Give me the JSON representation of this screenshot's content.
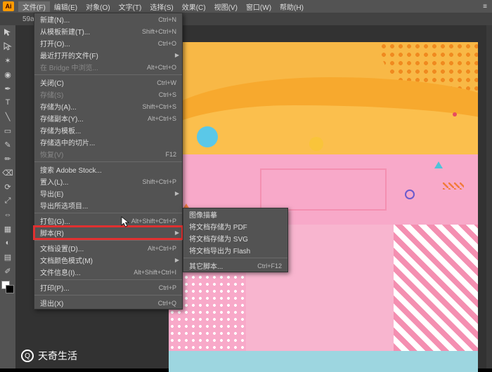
{
  "app": {
    "logo": "Ai"
  },
  "menubar": {
    "items": [
      {
        "label": "文件(F)"
      },
      {
        "label": "编辑(E)"
      },
      {
        "label": "对象(O)"
      },
      {
        "label": "文字(T)"
      },
      {
        "label": "选择(S)"
      },
      {
        "label": "效果(C)"
      },
      {
        "label": "视图(V)"
      },
      {
        "label": "窗口(W)"
      },
      {
        "label": "帮助(H)"
      }
    ]
  },
  "tab": {
    "label": "59a4…"
  },
  "menu_file": {
    "items": [
      {
        "label": "新建(N)...",
        "shortcut": "Ctrl+N"
      },
      {
        "label": "从模板新建(T)...",
        "shortcut": "Shift+Ctrl+N"
      },
      {
        "label": "打开(O)...",
        "shortcut": "Ctrl+O"
      },
      {
        "label": "最近打开的文件(F)",
        "arrow": true
      },
      {
        "label": "在 Bridge 中浏览...",
        "shortcut": "Alt+Ctrl+O",
        "disabled": true
      },
      {
        "sep": true
      },
      {
        "label": "关闭(C)",
        "shortcut": "Ctrl+W"
      },
      {
        "label": "存储(S)",
        "shortcut": "Ctrl+S",
        "disabled": true
      },
      {
        "label": "存储为(A)...",
        "shortcut": "Shift+Ctrl+S"
      },
      {
        "label": "存储副本(Y)...",
        "shortcut": "Alt+Ctrl+S"
      },
      {
        "label": "存储为模板..."
      },
      {
        "label": "存储选中的切片..."
      },
      {
        "label": "恢复(V)",
        "shortcut": "F12",
        "disabled": true
      },
      {
        "sep": true
      },
      {
        "label": "搜索 Adobe Stock..."
      },
      {
        "label": "置入(L)...",
        "shortcut": "Shift+Ctrl+P"
      },
      {
        "label": "导出(E)",
        "arrow": true
      },
      {
        "label": "导出所选项目..."
      },
      {
        "sep": true
      },
      {
        "label": "打包(G)...",
        "shortcut": "Alt+Shift+Ctrl+P"
      },
      {
        "label": "脚本(R)",
        "arrow": true,
        "highlight": true
      },
      {
        "sep": true
      },
      {
        "label": "文档设置(D)...",
        "shortcut": "Alt+Ctrl+P"
      },
      {
        "label": "文档颜色模式(M)",
        "arrow": true
      },
      {
        "label": "文件信息(I)...",
        "shortcut": "Alt+Shift+Ctrl+I"
      },
      {
        "sep": true
      },
      {
        "label": "打印(P)...",
        "shortcut": "Ctrl+P"
      },
      {
        "sep": true
      },
      {
        "label": "退出(X)",
        "shortcut": "Ctrl+Q"
      }
    ]
  },
  "submenu_scripts": {
    "items": [
      {
        "label": "图像描摹"
      },
      {
        "label": "将文档存储为 PDF"
      },
      {
        "label": "将文档存储为 SVG"
      },
      {
        "label": "将文档导出为 Flash"
      },
      {
        "sep": true
      },
      {
        "label": "其它脚本...",
        "shortcut": "Ctrl+F12"
      }
    ]
  },
  "watermark": {
    "text": "天奇生活"
  }
}
